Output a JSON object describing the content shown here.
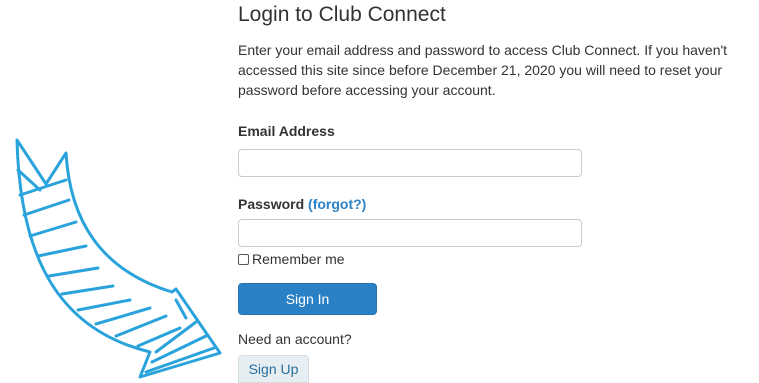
{
  "login": {
    "title": "Login to Club Connect",
    "intro": "Enter your email address and password to access Club Connect. If you haven't accessed this site since before December 21, 2020 you will need to reset your password before accessing your account.",
    "email_label": "Email Address",
    "email_value": "",
    "password_label": "Password",
    "forgot_link": "(forgot?)",
    "password_value": "",
    "remember_label": "Remember me",
    "remember_checked": false,
    "sign_in_label": "Sign In",
    "need_account": "Need an account?",
    "sign_up_label": "Sign Up"
  },
  "decoration": {
    "arrow_color": "#2aa3dc",
    "arrow_icon": "curved-arrow-icon"
  },
  "colors": {
    "primary_button": "#2a80c4",
    "link": "#2a82c7",
    "secondary_button_bg": "#e6eef2"
  }
}
